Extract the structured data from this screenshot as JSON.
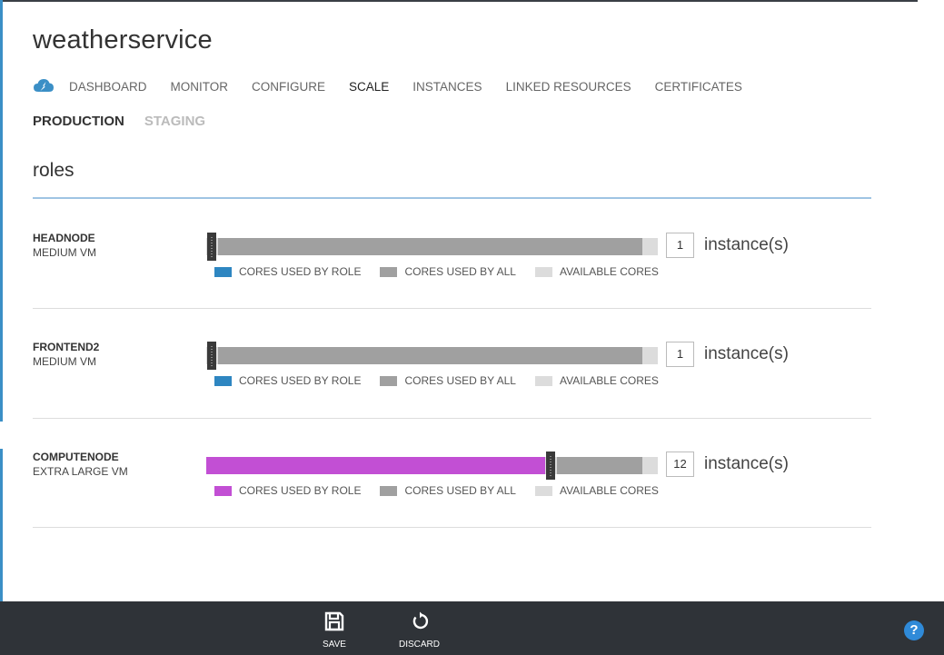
{
  "app": {
    "title": "weatherservice"
  },
  "nav": {
    "icon": "cloud-service-icon",
    "items": [
      {
        "label": "DASHBOARD",
        "active": false
      },
      {
        "label": "MONITOR",
        "active": false
      },
      {
        "label": "CONFIGURE",
        "active": false
      },
      {
        "label": "SCALE",
        "active": true
      },
      {
        "label": "INSTANCES",
        "active": false
      },
      {
        "label": "LINKED RESOURCES",
        "active": false
      },
      {
        "label": "CERTIFICATES",
        "active": false
      }
    ]
  },
  "environments": {
    "items": [
      {
        "label": "PRODUCTION",
        "active": true
      },
      {
        "label": "STAGING",
        "active": false
      }
    ]
  },
  "section": {
    "title": "roles"
  },
  "legend": {
    "role": "CORES USED BY ROLE",
    "all": "CORES USED BY ALL",
    "available": "AVAILABLE CORES"
  },
  "colors": {
    "role_default": "#2e86c1",
    "role_selected": "#c24fd4",
    "used_by_all": "#a0a0a0",
    "available": "#dcdcdc",
    "accent": "#3b8fc6",
    "command_bar": "#2f3338"
  },
  "roles": [
    {
      "name": "HEADNODE",
      "size": "MEDIUM VM",
      "instances": "1",
      "unit": "instance(s)",
      "role_fraction": 0.0,
      "all_fraction": 0.965,
      "role_color": "#2e86c1"
    },
    {
      "name": "FRONTEND2",
      "size": "MEDIUM VM",
      "instances": "1",
      "unit": "instance(s)",
      "role_fraction": 0.0,
      "all_fraction": 0.965,
      "role_color": "#2e86c1"
    },
    {
      "name": "COMPUTENODE",
      "size": "EXTRA LARGE VM",
      "instances": "12",
      "unit": "instance(s)",
      "role_fraction": 0.75,
      "all_fraction": 0.965,
      "role_color": "#c24fd4"
    }
  ],
  "commands": {
    "save": {
      "label": "SAVE",
      "icon": "save-icon"
    },
    "discard": {
      "label": "DISCARD",
      "icon": "undo-icon"
    }
  },
  "help": {
    "glyph": "?",
    "icon": "help-icon"
  }
}
